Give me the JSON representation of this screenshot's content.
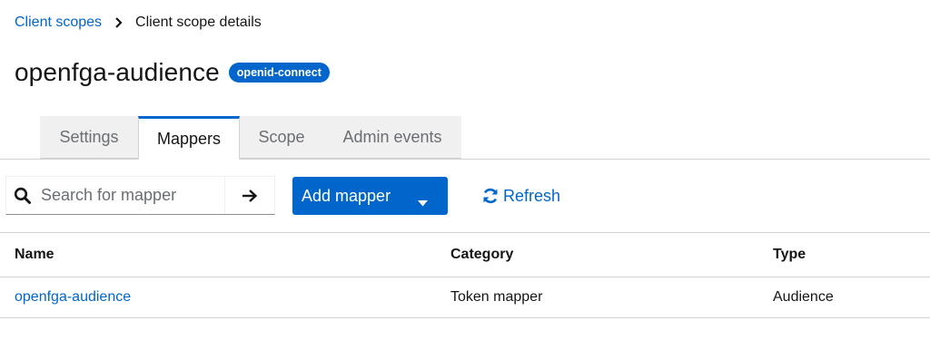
{
  "breadcrumb": {
    "parent": "Client scopes",
    "current": "Client scope details"
  },
  "header": {
    "title": "openfga-audience",
    "badge": "openid-connect"
  },
  "tabs": [
    {
      "label": "Settings",
      "active": false
    },
    {
      "label": "Mappers",
      "active": true
    },
    {
      "label": "Scope",
      "active": false
    },
    {
      "label": "Admin events",
      "active": false
    }
  ],
  "toolbar": {
    "search_placeholder": "Search for mapper",
    "add_label": "Add mapper",
    "refresh_label": "Refresh"
  },
  "table": {
    "columns": [
      "Name",
      "Category",
      "Type"
    ],
    "rows": [
      {
        "name": "openfga-audience",
        "category": "Token mapper",
        "type": "Audience"
      }
    ]
  },
  "colors": {
    "accent": "#0066cc",
    "tab_inactive_bg": "#f0f0f0",
    "border": "#d2d2d2"
  }
}
